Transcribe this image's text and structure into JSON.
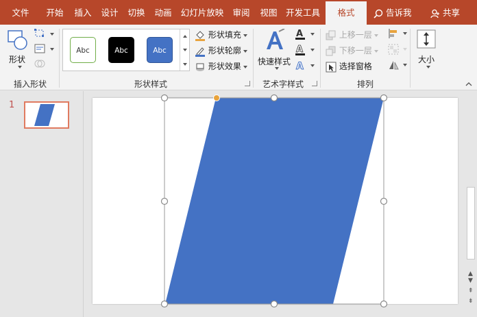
{
  "tabs": [
    {
      "label": "文件",
      "active": false
    },
    {
      "label": "开始",
      "active": false
    },
    {
      "label": "插入",
      "active": false
    },
    {
      "label": "设计",
      "active": false
    },
    {
      "label": "切换",
      "active": false
    },
    {
      "label": "动画",
      "active": false
    },
    {
      "label": "幻灯片放映",
      "active": false
    },
    {
      "label": "审阅",
      "active": false
    },
    {
      "label": "视图",
      "active": false
    },
    {
      "label": "开发工具",
      "active": false
    },
    {
      "label": "格式",
      "active": true
    }
  ],
  "tell_me": "告诉我",
  "share": "共享",
  "ribbon": {
    "insert_shapes": {
      "shapes_label": "形状",
      "group_label": "插入形状"
    },
    "shape_styles": {
      "swatches": [
        {
          "label": "Abc",
          "fill": "#ffffff",
          "border": "#70ad47",
          "text": "#333333"
        },
        {
          "label": "Abc",
          "fill": "#000000",
          "border": "#000000",
          "text": "#ffffff"
        },
        {
          "label": "Abc",
          "fill": "#4472c4",
          "border": "#2f5597",
          "text": "#ffffff"
        }
      ],
      "fill_label": "形状填充",
      "outline_label": "形状轮廓",
      "effects_label": "形状效果",
      "group_label": "形状样式"
    },
    "wordart": {
      "quick_styles_label": "快速样式",
      "group_label": "艺术字样式"
    },
    "arrange": {
      "bring_forward": "上移一层",
      "send_backward": "下移一层",
      "selection_pane": "选择窗格",
      "group_label": "排列"
    },
    "size": {
      "size_label": "大小"
    }
  },
  "slides": {
    "number": "1"
  },
  "colors": {
    "accent": "#b7472a",
    "shape_fill": "#4472c4",
    "rotate_handle": "#e8a33d"
  }
}
